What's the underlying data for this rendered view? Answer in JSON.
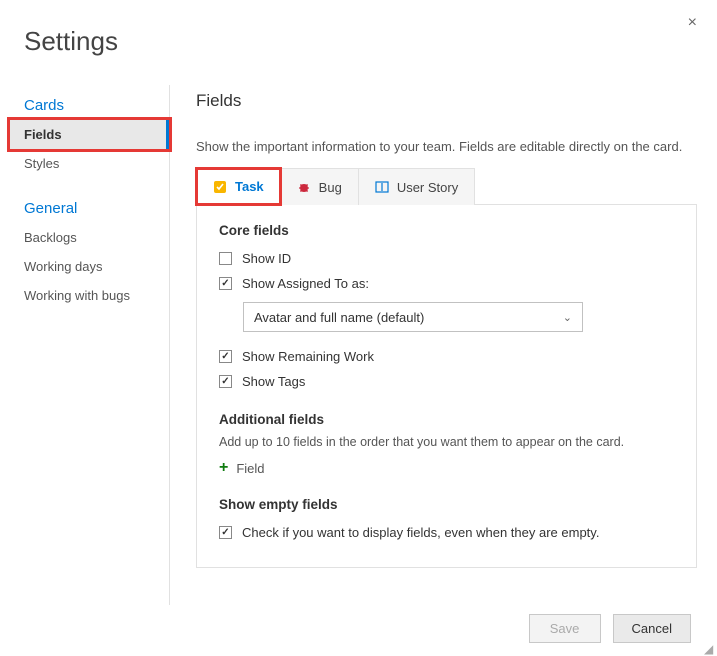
{
  "title": "Settings",
  "close_label": "×",
  "sidebar": {
    "groups": [
      {
        "heading": "Cards",
        "items": [
          {
            "label": "Fields",
            "selected": true,
            "highlighted": true
          },
          {
            "label": "Styles"
          }
        ]
      },
      {
        "heading": "General",
        "items": [
          {
            "label": "Backlogs"
          },
          {
            "label": "Working days"
          },
          {
            "label": "Working with bugs"
          }
        ]
      }
    ]
  },
  "content": {
    "title": "Fields",
    "description": "Show the important information to your team. Fields are editable directly on the card.",
    "tabs": [
      {
        "label": "Task",
        "icon": "task-icon",
        "active": true,
        "highlighted": true
      },
      {
        "label": "Bug",
        "icon": "bug-icon"
      },
      {
        "label": "User Story",
        "icon": "story-icon"
      }
    ],
    "core_heading": "Core fields",
    "core_fields": {
      "show_id": {
        "label": "Show ID",
        "checked": false
      },
      "assigned_to": {
        "label": "Show Assigned To as:",
        "checked": true,
        "select_value": "Avatar and full name (default)"
      },
      "remaining_work": {
        "label": "Show Remaining Work",
        "checked": true
      },
      "show_tags": {
        "label": "Show Tags",
        "checked": true
      }
    },
    "additional": {
      "heading": "Additional fields",
      "description": "Add up to 10 fields in the order that you want them to appear on the card.",
      "add_label": "Field"
    },
    "empty": {
      "heading": "Show empty fields",
      "label": "Check if you want to display fields, even when they are empty.",
      "checked": true
    }
  },
  "buttons": {
    "save": "Save",
    "cancel": "Cancel"
  }
}
